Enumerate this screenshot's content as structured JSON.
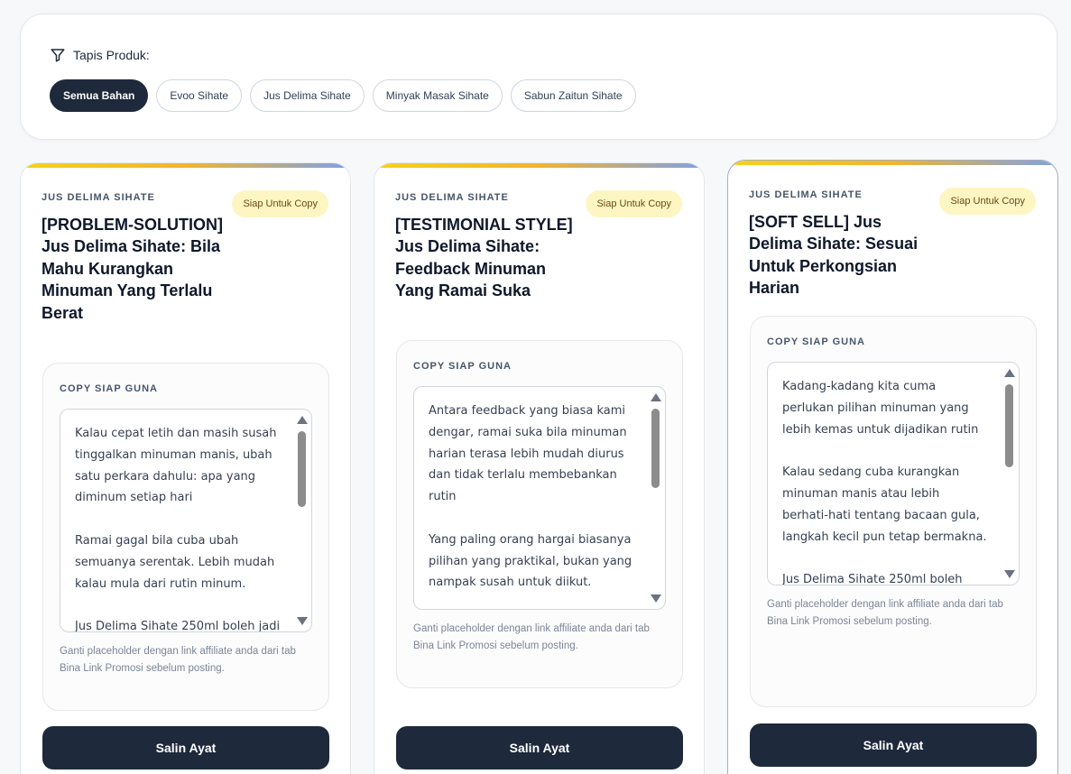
{
  "filter": {
    "label": "Tapis Produk:",
    "chips": [
      {
        "label": "Semua Bahan",
        "active": true
      },
      {
        "label": "Evoo Sihate",
        "active": false
      },
      {
        "label": "Jus Delima Sihate",
        "active": false
      },
      {
        "label": "Minyak Masak Sihate",
        "active": false
      },
      {
        "label": "Sabun Zaitun Sihate",
        "active": false
      }
    ]
  },
  "cards": [
    {
      "category": "JUS DELIMA SIHATE",
      "badge": "Siap Untuk Copy",
      "title": "[PROBLEM-SOLUTION] Jus Delima Sihate: Bila Mahu Kurangkan Minuman Yang Terlalu Berat",
      "copy_label": "COPY SIAP GUNA",
      "copy_text": "Kalau cepat letih dan masih susah tinggalkan minuman manis, ubah satu perkara dahulu: apa yang diminum setiap hari\n\nRamai gagal bila cuba ubah semuanya serentak. Lebih mudah kalau mula dari rutin minum.\n\nJus Delima Sihate 250ml boleh jadi",
      "hint": "Ganti placeholder dengan link affiliate anda dari tab Bina Link Promosi sebelum posting.",
      "button": "Salin Ayat"
    },
    {
      "category": "JUS DELIMA SIHATE",
      "badge": "Siap Untuk Copy",
      "title": "[TESTIMONIAL STYLE] Jus Delima Sihate: Feedback Minuman Yang Ramai Suka",
      "copy_label": "COPY SIAP GUNA",
      "copy_text": "Antara feedback yang biasa kami dengar, ramai suka bila minuman harian terasa lebih mudah diurus dan tidak terlalu membebankan rutin\n\nYang paling orang hargai biasanya pilihan yang praktikal, bukan yang nampak susah untuk diikut.",
      "hint": "Ganti placeholder dengan link affiliate anda dari tab Bina Link Promosi sebelum posting.",
      "button": "Salin Ayat"
    },
    {
      "category": "JUS DELIMA SIHATE",
      "badge": "Siap Untuk Copy",
      "title": "[SOFT SELL] Jus Delima Sihate: Sesuai Untuk Perkongsian Harian",
      "copy_label": "COPY SIAP GUNA",
      "copy_text": "Kadang-kadang kita cuma perlukan pilihan minuman yang lebih kemas untuk dijadikan rutin\n\nKalau sedang cuba kurangkan minuman manis atau lebih berhati-hati tentang bacaan gula, langkah kecil pun tetap bermakna.\n\nJus Delima Sihate 250ml boleh",
      "hint": "Ganti placeholder dengan link affiliate anda dari tab Bina Link Promosi sebelum posting.",
      "button": "Salin Ayat"
    }
  ]
}
